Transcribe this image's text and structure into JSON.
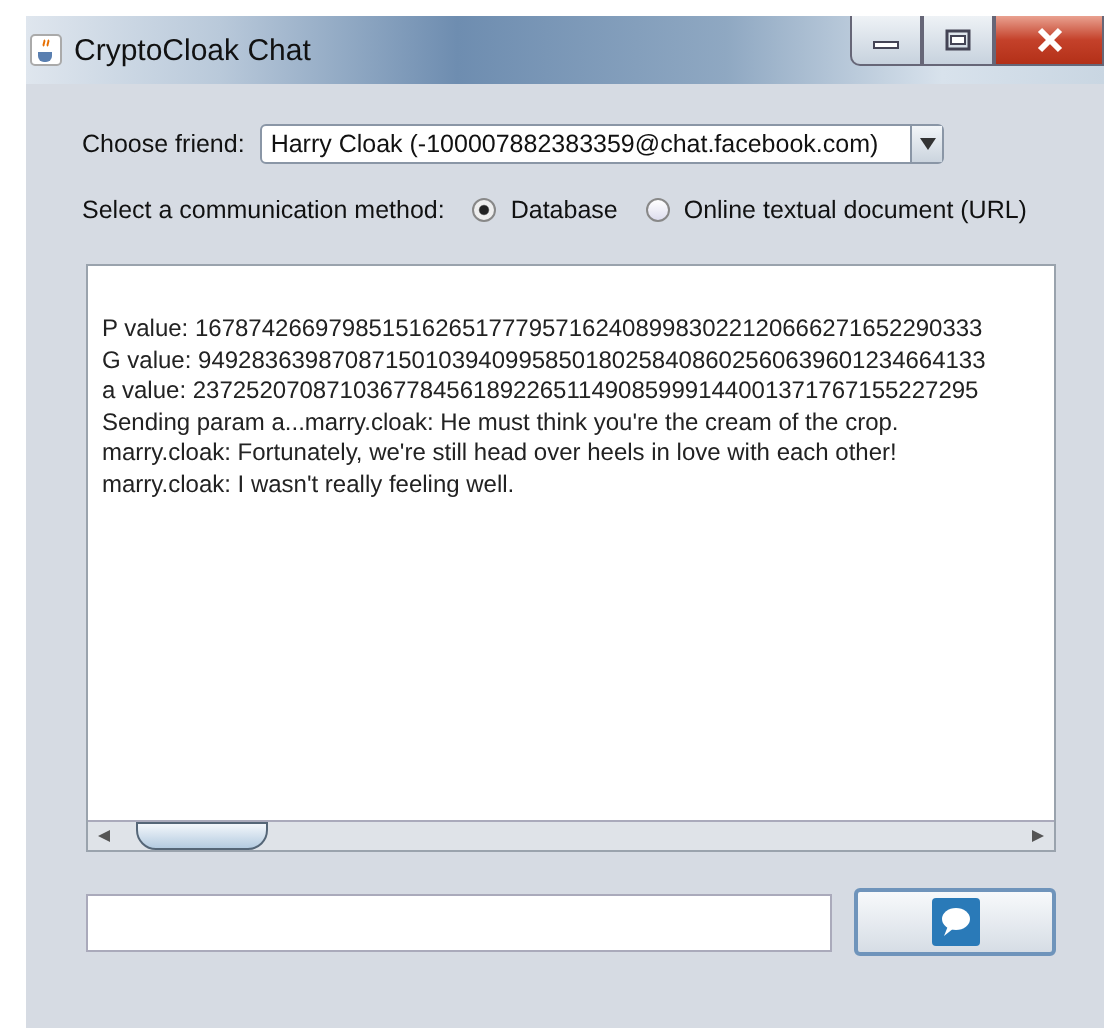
{
  "window": {
    "title": "CryptoCloak Chat"
  },
  "friend": {
    "label": "Choose friend:",
    "value": "Harry Cloak (-100007882383359@chat.facebook.com)"
  },
  "method": {
    "label": "Select a communication method:",
    "options": [
      {
        "label": "Database",
        "selected": true
      },
      {
        "label": "Online textual document (URL)",
        "selected": false
      }
    ]
  },
  "log": [
    "P value: 16787426697985151626517779571624089983022120666271652290333",
    "G value: 94928363987087150103940995850180258408602560639601234664133",
    "a value: 23725207087103677845618922651149085999144001371767155227295",
    "Sending param a...marry.cloak: He must think you're the cream of the crop.",
    "marry.cloak: Fortunately, we're still head over heels in love with each other!",
    "marry.cloak: I wasn't really feeling well."
  ]
}
